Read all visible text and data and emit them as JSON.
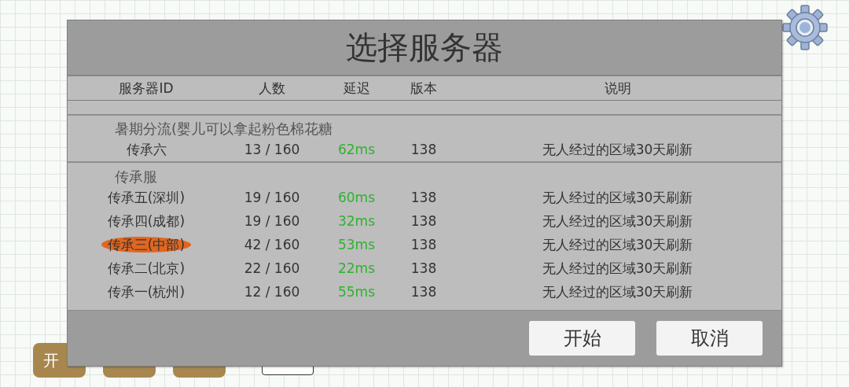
{
  "background": {
    "start_button": {
      "label": "开"
    }
  },
  "dialog": {
    "title": "选择服务器",
    "columns": [
      "服务器ID",
      "人数",
      "延迟",
      "版本",
      "说明"
    ],
    "groups": [
      {
        "title": "暑期分流(婴儿可以拿起粉色棉花糖",
        "rows": [
          {
            "id": "传承六",
            "players": "13 / 160",
            "latency": "62ms",
            "version": "138",
            "note": "无人经过的区域30天刷新",
            "selected": false
          }
        ]
      },
      {
        "title": "传承服",
        "rows": [
          {
            "id": "传承五(深圳)",
            "players": "19 / 160",
            "latency": "60ms",
            "version": "138",
            "note": "无人经过的区域30天刷新",
            "selected": false
          },
          {
            "id": "传承四(成都)",
            "players": "19 / 160",
            "latency": "32ms",
            "version": "138",
            "note": "无人经过的区域30天刷新",
            "selected": false
          },
          {
            "id": "传承三(中部)",
            "players": "42 / 160",
            "latency": "53ms",
            "version": "138",
            "note": "无人经过的区域30天刷新",
            "selected": true
          },
          {
            "id": "传承二(北京)",
            "players": "22 / 160",
            "latency": "22ms",
            "version": "138",
            "note": "无人经过的区域30天刷新",
            "selected": false
          },
          {
            "id": "传承一(杭州)",
            "players": "12 / 160",
            "latency": "55ms",
            "version": "138",
            "note": "无人经过的区域30天刷新",
            "selected": false
          }
        ]
      }
    ],
    "buttons": [
      "开始",
      "取消"
    ]
  }
}
